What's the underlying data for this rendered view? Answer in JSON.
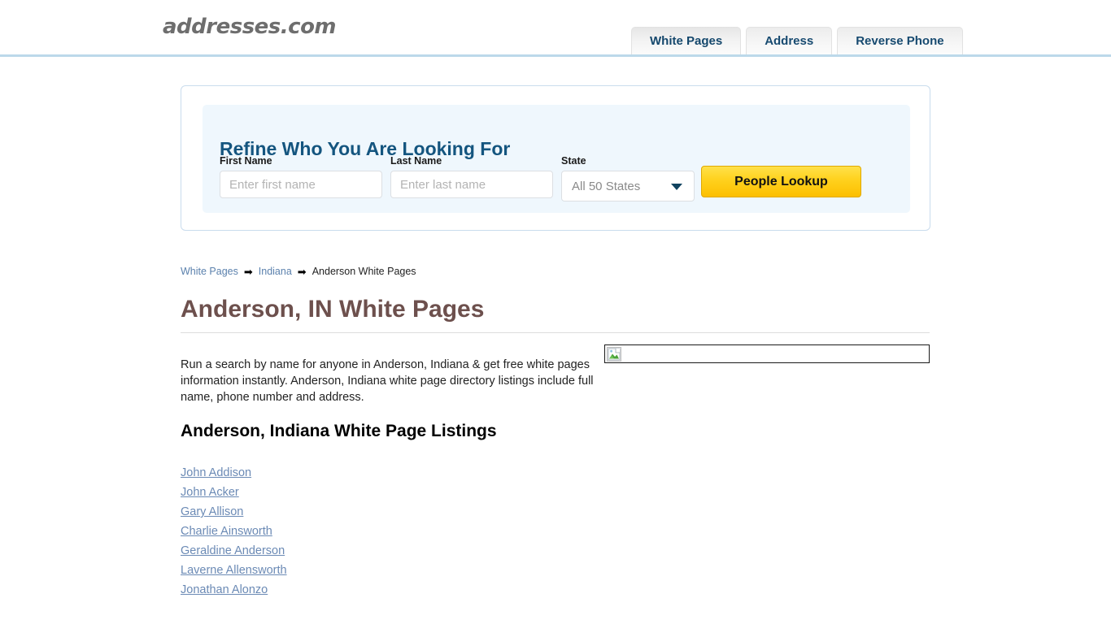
{
  "header": {
    "logo": "addresses.com",
    "tabs": [
      {
        "label": "White Pages",
        "active": true
      },
      {
        "label": "Address",
        "active": false
      },
      {
        "label": "Reverse Phone",
        "active": false
      }
    ]
  },
  "refine_panel": {
    "title": "Refine Who You Are Looking For",
    "first_name": {
      "label": "First Name",
      "placeholder": "Enter first name",
      "value": ""
    },
    "last_name": {
      "label": "Last Name",
      "placeholder": "Enter last name",
      "value": ""
    },
    "state": {
      "label": "State",
      "selected": "All 50 States"
    },
    "submit_label": "People Lookup"
  },
  "breadcrumb": {
    "items": [
      "White Pages",
      "Indiana",
      "Anderson White Pages"
    ],
    "separator": "➡"
  },
  "page": {
    "title": "Anderson, IN White Pages",
    "intro": "Run a search by name for anyone in Anderson, Indiana & get free white pages information instantly. Anderson, Indiana white page directory listings include full name, phone number and address.",
    "listings_title": "Anderson, Indiana White Page Listings",
    "listings": [
      "John Addison",
      "John Acker",
      "Gary Allison",
      "Charlie Ainsworth",
      "Geraldine Anderson",
      "Laverne Allensworth",
      "Jonathan Alonzo"
    ]
  },
  "colors": {
    "brand_blue": "#14557f",
    "tab_text": "#174a70",
    "title_brown": "#6d504d",
    "link_blue": "#6b8ab5",
    "button_gold": "#ffd21f",
    "panel_bg": "#eff7fd",
    "header_rule": "#bcd9ea"
  }
}
